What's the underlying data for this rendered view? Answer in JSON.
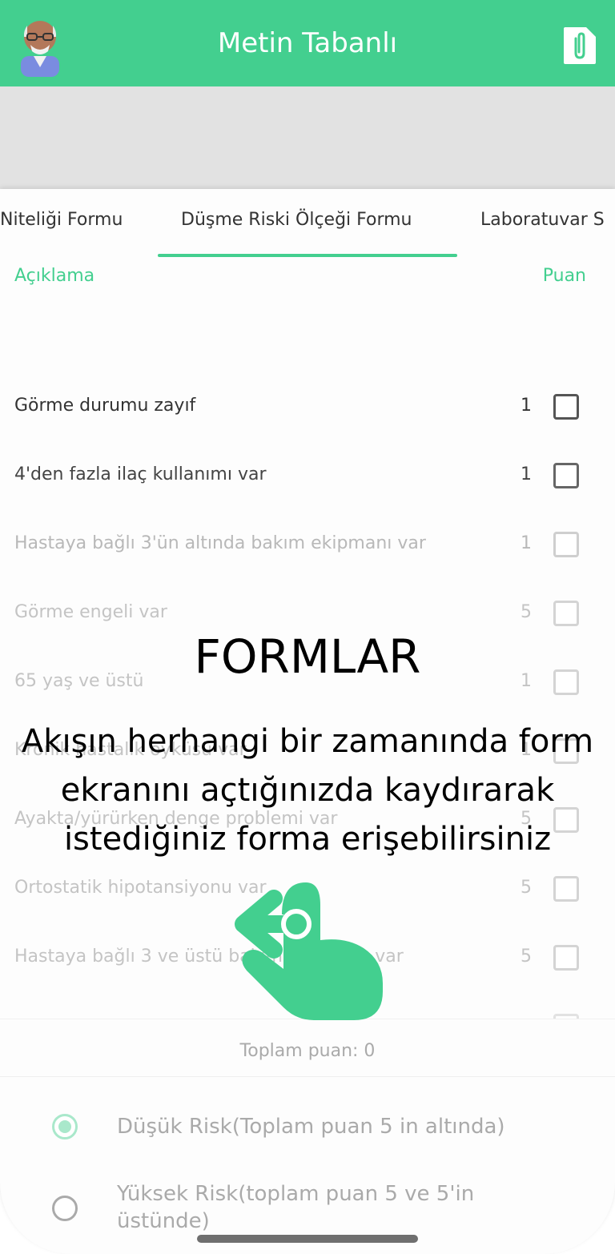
{
  "appbar": {
    "title": "Metin Tabanlı"
  },
  "tabs": [
    {
      "label": "Niteliği Formu"
    },
    {
      "label": "Düşme Riski Ölçeği Formu"
    },
    {
      "label": "Laboratuvar S"
    }
  ],
  "header": {
    "description": "Açıklama",
    "score": "Puan"
  },
  "rows": [
    {
      "text": "Görme durumu zayıf",
      "score": "1"
    },
    {
      "text": "4'den fazla ilaç kullanımı var",
      "score": "1"
    },
    {
      "text": "Hastaya bağlı 3'ün altında bakım ekipmanı var",
      "score": "1"
    },
    {
      "text": "Görme engeli var",
      "score": "5"
    },
    {
      "text": "65 yaş ve üstü",
      "score": "1"
    },
    {
      "text": "Kronik hastalık öyküsü var",
      "score": "1"
    },
    {
      "text": "Ayakta/yürürken denge problemi var",
      "score": "5"
    },
    {
      "text": "Ortostatik hipotansiyonu var",
      "score": "5"
    },
    {
      "text": "Hastaya bağlı 3 ve üstü bakım ekipmanı var",
      "score": "5"
    }
  ],
  "total": "Toplam puan: 0",
  "risk": {
    "low": "Düşük Risk(Toplam puan 5 in altında)",
    "high": "Yüksek Risk(toplam puan 5 ve 5'in üstünde)"
  },
  "overlay": {
    "title": "FORMLAR",
    "description": "Akışın herhangi bir zamanında form ekranını açtığınızda kaydırarak istediğiniz forma erişebilirsiniz"
  },
  "colors": {
    "accent": "#43cf8f",
    "accent_light": "#a9e8cb"
  },
  "icons": {
    "avatar": "elderly-man-avatar-icon",
    "doc": "attachment-document-icon",
    "hand": "swipe-left-hand-icon"
  }
}
